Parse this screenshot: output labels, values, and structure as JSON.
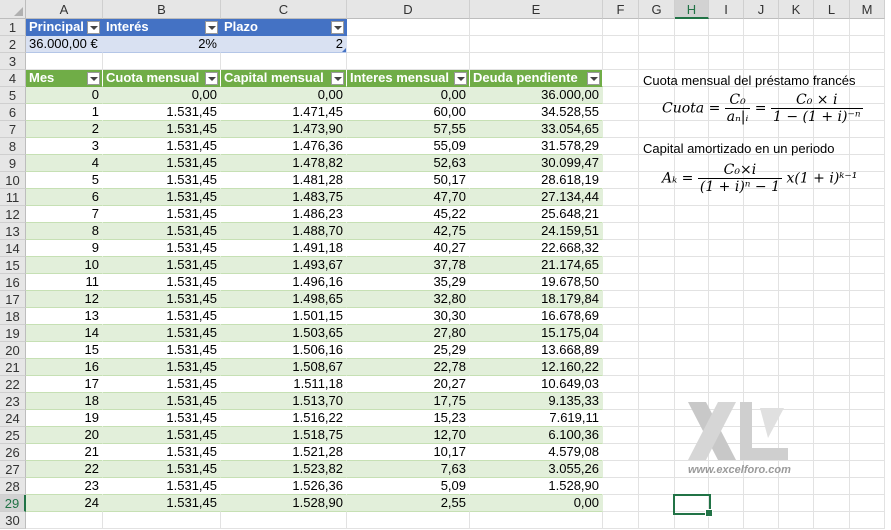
{
  "columns": [
    "A",
    "B",
    "C",
    "D",
    "E",
    "F",
    "G",
    "H",
    "I",
    "J",
    "K",
    "L",
    "M"
  ],
  "selected_column": "H",
  "selected_row": 29,
  "params": {
    "headers": [
      "Principal",
      "Interés",
      "Plazo"
    ],
    "values": [
      "36.000,00 €",
      "2%",
      "2"
    ]
  },
  "amort": {
    "headers": [
      "Mes",
      "Cuota mensual",
      "Capital mensual",
      "Interes mensual",
      "Deuda pendiente"
    ],
    "rows": [
      [
        "0",
        "0,00",
        "0,00",
        "0,00",
        "36.000,00"
      ],
      [
        "1",
        "1.531,45",
        "1.471,45",
        "60,00",
        "34.528,55"
      ],
      [
        "2",
        "1.531,45",
        "1.473,90",
        "57,55",
        "33.054,65"
      ],
      [
        "3",
        "1.531,45",
        "1.476,36",
        "55,09",
        "31.578,29"
      ],
      [
        "4",
        "1.531,45",
        "1.478,82",
        "52,63",
        "30.099,47"
      ],
      [
        "5",
        "1.531,45",
        "1.481,28",
        "50,17",
        "28.618,19"
      ],
      [
        "6",
        "1.531,45",
        "1.483,75",
        "47,70",
        "27.134,44"
      ],
      [
        "7",
        "1.531,45",
        "1.486,23",
        "45,22",
        "25.648,21"
      ],
      [
        "8",
        "1.531,45",
        "1.488,70",
        "42,75",
        "24.159,51"
      ],
      [
        "9",
        "1.531,45",
        "1.491,18",
        "40,27",
        "22.668,32"
      ],
      [
        "10",
        "1.531,45",
        "1.493,67",
        "37,78",
        "21.174,65"
      ],
      [
        "11",
        "1.531,45",
        "1.496,16",
        "35,29",
        "19.678,50"
      ],
      [
        "12",
        "1.531,45",
        "1.498,65",
        "32,80",
        "18.179,84"
      ],
      [
        "13",
        "1.531,45",
        "1.501,15",
        "30,30",
        "16.678,69"
      ],
      [
        "14",
        "1.531,45",
        "1.503,65",
        "27,80",
        "15.175,04"
      ],
      [
        "15",
        "1.531,45",
        "1.506,16",
        "25,29",
        "13.668,89"
      ],
      [
        "16",
        "1.531,45",
        "1.508,67",
        "22,78",
        "12.160,22"
      ],
      [
        "17",
        "1.531,45",
        "1.511,18",
        "20,27",
        "10.649,03"
      ],
      [
        "18",
        "1.531,45",
        "1.513,70",
        "17,75",
        "9.135,33"
      ],
      [
        "19",
        "1.531,45",
        "1.516,22",
        "15,23",
        "7.619,11"
      ],
      [
        "20",
        "1.531,45",
        "1.518,75",
        "12,70",
        "6.100,36"
      ],
      [
        "21",
        "1.531,45",
        "1.521,28",
        "10,17",
        "4.579,08"
      ],
      [
        "22",
        "1.531,45",
        "1.523,82",
        "7,63",
        "3.055,26"
      ],
      [
        "23",
        "1.531,45",
        "1.526,36",
        "5,09",
        "1.528,90"
      ],
      [
        "24",
        "1.531,45",
        "1.528,90",
        "2,55",
        "0,00"
      ]
    ]
  },
  "formulas": {
    "cuota_title": "Cuota mensual del préstamo francés",
    "cuota_lhs": "Cuota =",
    "cuota_num1": "C₀",
    "cuota_den1": "aₙ|ᵢ",
    "cuota_eq": "=",
    "cuota_num2": "C₀ × i",
    "cuota_den2": "1 − (1 + i)⁻ⁿ",
    "capital_title": "Capital amortizado en un periodo",
    "capital_lhs": "Aₖ =",
    "capital_num": "C₀×i",
    "capital_den": "(1 + i)ⁿ − 1",
    "capital_tail": "x(1 + i)ᵏ⁻¹"
  },
  "watermark": {
    "logo_text": "XL",
    "url": "www.excelforo.com"
  },
  "colors": {
    "blue_header": "#4472c4",
    "blue_band": "#d9e1f2",
    "green_header": "#70ad47",
    "green_band": "#e2efda",
    "selection": "#217346"
  }
}
